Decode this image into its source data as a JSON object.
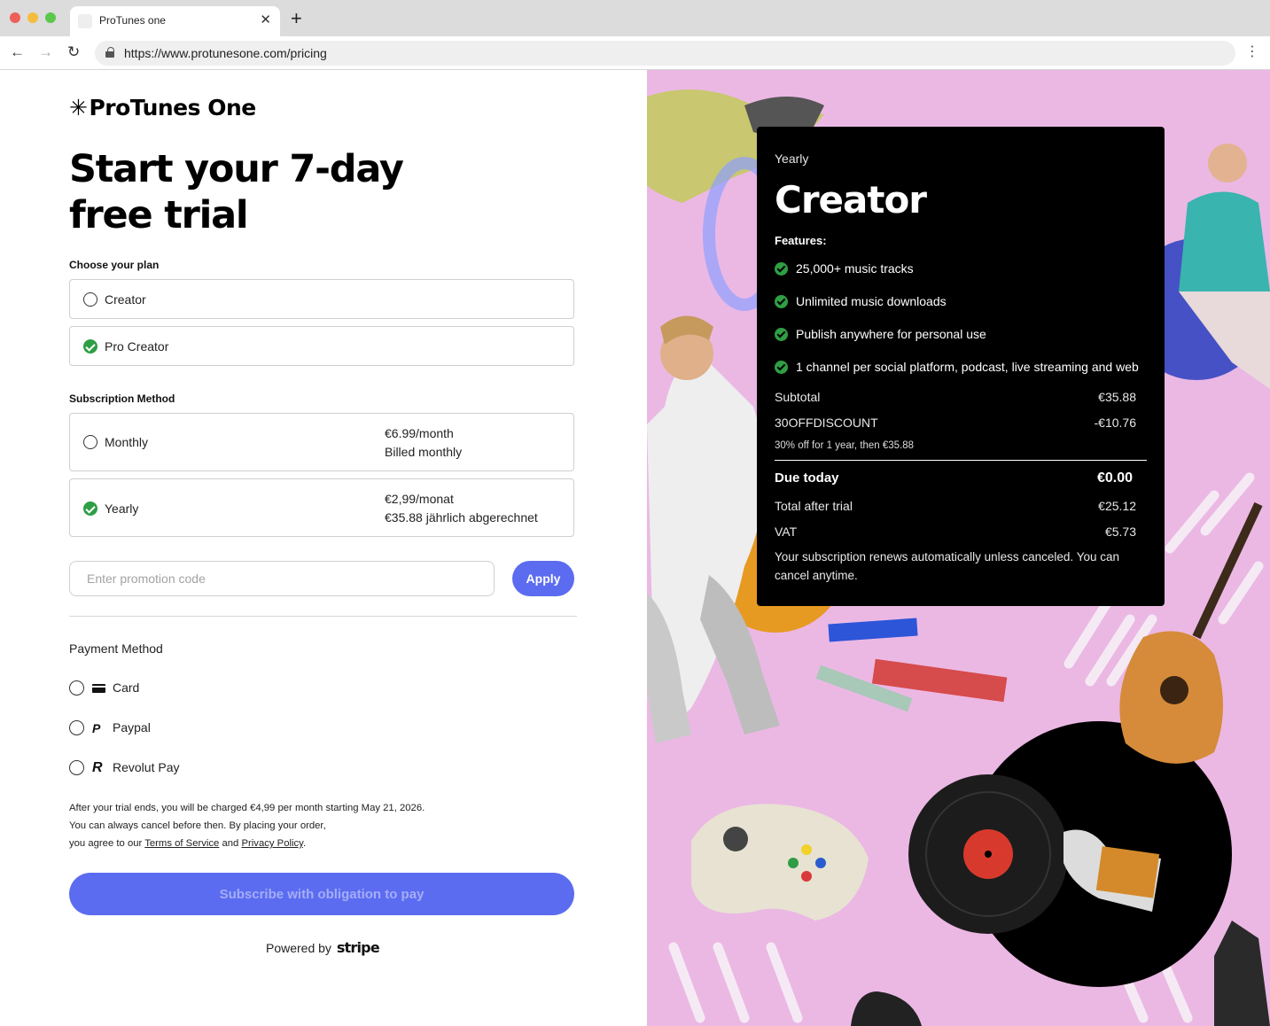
{
  "browser": {
    "tab_title": "ProTunes one",
    "url": "https://www.protunesone.com/pricing"
  },
  "brand": {
    "logo_text": "ProTunes One",
    "accent_color": "#5b6cf0",
    "success_color": "#2f9e44"
  },
  "checkout": {
    "headline": "Start your 7-day free trial",
    "plan_section_label": "Choose your plan",
    "plans": [
      {
        "label": "Creator",
        "selected": false
      },
      {
        "label": "Pro Creator",
        "selected": true
      }
    ],
    "subscription_section_label": "Subscription Method",
    "methods": [
      {
        "label": "Monthly",
        "price": "€6.99/month",
        "billing": "Billed monthly",
        "selected": false
      },
      {
        "label": "Yearly",
        "price": "€2,99/monat",
        "billing": "€35.88 jährlich abgerechnet",
        "selected": true
      }
    ],
    "promo_placeholder": "Enter promotion code",
    "apply_label": "Apply",
    "payment_section_label": "Payment Method",
    "payment_methods": [
      {
        "label": "Card",
        "icon": "card-icon"
      },
      {
        "label": "Paypal",
        "icon": "paypal-icon"
      },
      {
        "label": "Revolut Pay",
        "icon": "revolut-icon"
      }
    ],
    "legal_line1": "After your trial ends, you will be charged €4,99 per month starting May 21, 2026.",
    "legal_line2": "You can always cancel before then. By placing your order,",
    "legal_line3_prefix": "you agree to our",
    "terms_link": "Terms of Service",
    "legal_and": "and",
    "privacy_link": "Privacy Policy",
    "legal_end": ".",
    "subscribe_label": "Subscribe with obligation to pay",
    "powered_by": "Powered by",
    "stripe": "stripe"
  },
  "summary": {
    "period": "Yearly",
    "plan_name": "Creator",
    "features_label": "Features:",
    "features": [
      "25,000+ music tracks",
      "Unlimited music downloads",
      "Publish anywhere for personal use",
      "1 channel per social platform, podcast, live streaming and web"
    ],
    "subtotal_label": "Subtotal",
    "subtotal_value": "€35.88",
    "discount_label": "30OFFDISCOUNT",
    "discount_value": "-€10.76",
    "discount_note": "30% off for 1 year, then €35.88",
    "due_today_label": "Due today",
    "due_today_value": "€0.00",
    "total_after_label": "Total after trial",
    "total_after_value": "€25.12",
    "vat_label": "VAT",
    "vat_value": "€5.73",
    "renewal_note": "Your subscription renews automatically unless canceled. You can cancel anytime."
  }
}
